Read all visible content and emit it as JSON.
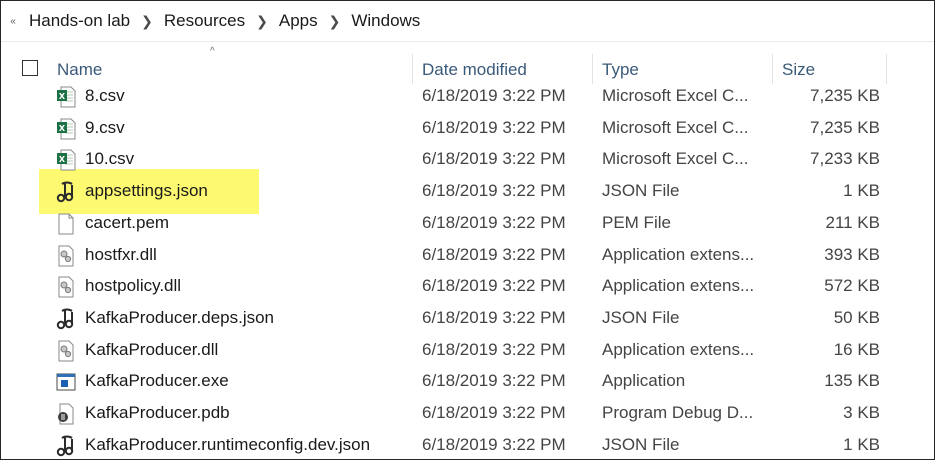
{
  "breadcrumb": {
    "expander_icon": "double-chevron-left-icon",
    "separator_icon": "chevron-right-icon",
    "items": [
      "Hands-on lab",
      "Resources",
      "Apps",
      "Windows"
    ]
  },
  "header": {
    "sort_indicator": "^",
    "columns": {
      "name": "Name",
      "date_modified": "Date modified",
      "type": "Type",
      "size": "Size"
    }
  },
  "colors": {
    "highlight": "#fdfa72",
    "excel_green": "#1e7145",
    "header_text": "#3a5a7a"
  },
  "files": [
    {
      "name": "8.csv",
      "date": "6/18/2019 3:22 PM",
      "type": "Microsoft Excel C...",
      "size": "7,235 KB",
      "icon": "excel-csv-icon"
    },
    {
      "name": "9.csv",
      "date": "6/18/2019 3:22 PM",
      "type": "Microsoft Excel C...",
      "size": "7,235 KB",
      "icon": "excel-csv-icon"
    },
    {
      "name": "10.csv",
      "date": "6/18/2019 3:22 PM",
      "type": "Microsoft Excel C...",
      "size": "7,233 KB",
      "icon": "excel-csv-icon"
    },
    {
      "name": "appsettings.json",
      "date": "6/18/2019 3:22 PM",
      "type": "JSON File",
      "size": "1 KB",
      "icon": "json-file-icon",
      "highlighted": true
    },
    {
      "name": "cacert.pem",
      "date": "6/18/2019 3:22 PM",
      "type": "PEM File",
      "size": "211 KB",
      "icon": "blank-file-icon"
    },
    {
      "name": "hostfxr.dll",
      "date": "6/18/2019 3:22 PM",
      "type": "Application extens...",
      "size": "393 KB",
      "icon": "dll-file-icon"
    },
    {
      "name": "hostpolicy.dll",
      "date": "6/18/2019 3:22 PM",
      "type": "Application extens...",
      "size": "572 KB",
      "icon": "dll-file-icon"
    },
    {
      "name": "KafkaProducer.deps.json",
      "date": "6/18/2019 3:22 PM",
      "type": "JSON File",
      "size": "50 KB",
      "icon": "json-file-icon"
    },
    {
      "name": "KafkaProducer.dll",
      "date": "6/18/2019 3:22 PM",
      "type": "Application extens...",
      "size": "16 KB",
      "icon": "dll-file-icon"
    },
    {
      "name": "KafkaProducer.exe",
      "date": "6/18/2019 3:22 PM",
      "type": "Application",
      "size": "135 KB",
      "icon": "exe-file-icon"
    },
    {
      "name": "KafkaProducer.pdb",
      "date": "6/18/2019 3:22 PM",
      "type": "Program Debug D...",
      "size": "3 KB",
      "icon": "pdb-file-icon"
    },
    {
      "name": "KafkaProducer.runtimeconfig.dev.json",
      "date": "6/18/2019 3:22 PM",
      "type": "JSON File",
      "size": "1 KB",
      "icon": "json-file-icon"
    }
  ]
}
